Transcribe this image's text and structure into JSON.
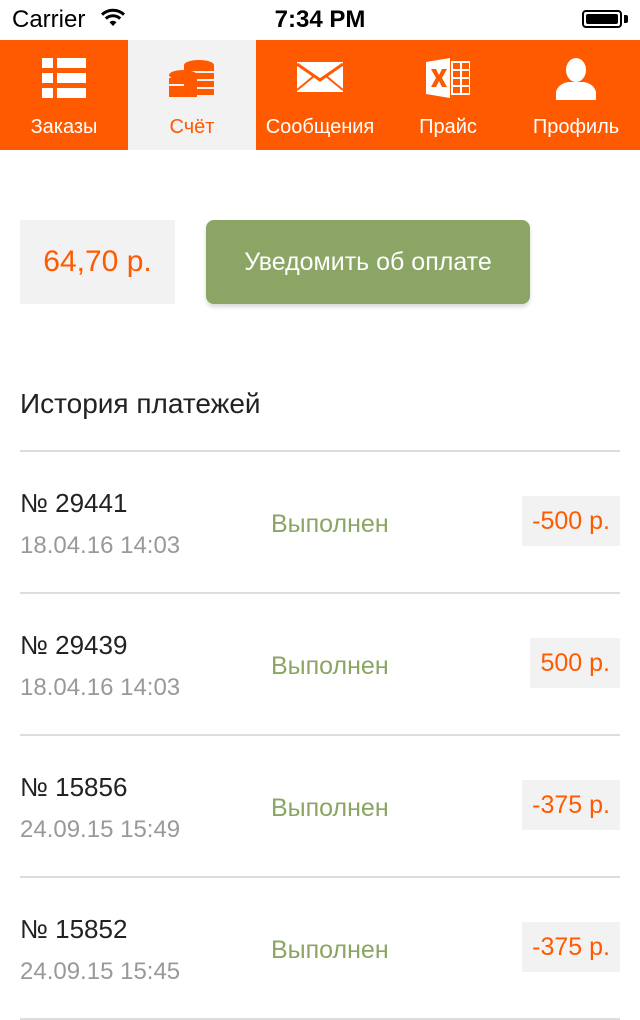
{
  "status_bar": {
    "carrier": "Carrier",
    "time": "7:34 PM"
  },
  "tabs": [
    {
      "label": "Заказы",
      "icon": "list-icon",
      "active": false
    },
    {
      "label": "Счёт",
      "icon": "coins-icon",
      "active": true
    },
    {
      "label": "Сообщения",
      "icon": "envelope-icon",
      "active": false
    },
    {
      "label": "Прайс",
      "icon": "excel-icon",
      "active": false
    },
    {
      "label": "Профиль",
      "icon": "user-icon",
      "active": false
    }
  ],
  "account": {
    "balance": "64,70 р.",
    "notify_button": "Уведомить об оплате"
  },
  "history": {
    "title": "История платежей",
    "rows": [
      {
        "number": "№ 29441",
        "date": "18.04.16 14:03",
        "status": "Выполнен",
        "amount": "-500 р."
      },
      {
        "number": "№ 29439",
        "date": "18.04.16 14:03",
        "status": "Выполнен",
        "amount": "500 р."
      },
      {
        "number": "№ 15856",
        "date": "24.09.15 15:49",
        "status": "Выполнен",
        "amount": "-375 р."
      },
      {
        "number": "№ 15852",
        "date": "24.09.15 15:45",
        "status": "Выполнен",
        "amount": "-375 р."
      }
    ]
  },
  "colors": {
    "accent": "#ff5a00",
    "green": "#8aa564",
    "light_gray": "#f2f2f2"
  }
}
